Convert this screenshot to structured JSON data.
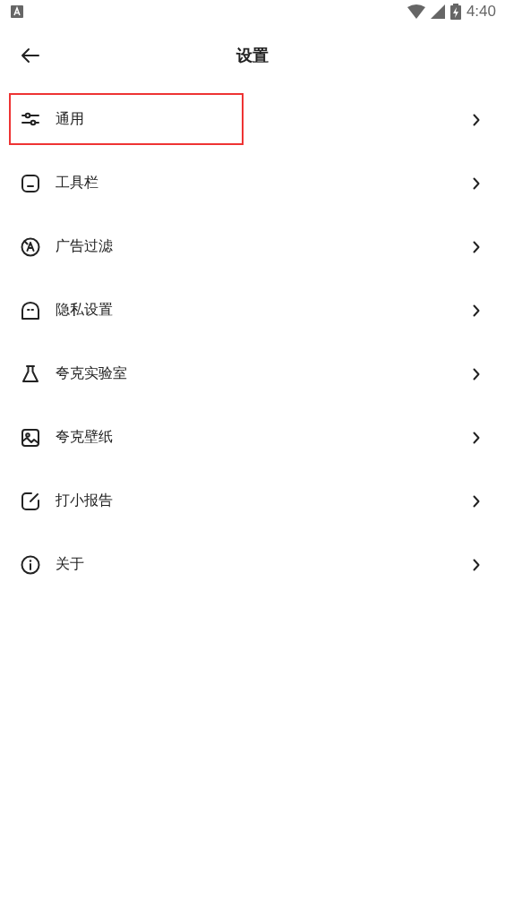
{
  "status_bar": {
    "time": "4:40"
  },
  "header": {
    "title": "设置"
  },
  "items": [
    {
      "label": "通用",
      "highlighted": true
    },
    {
      "label": "工具栏",
      "highlighted": false
    },
    {
      "label": "广告过滤",
      "highlighted": false
    },
    {
      "label": "隐私设置",
      "highlighted": false
    },
    {
      "label": "夸克实验室",
      "highlighted": false
    },
    {
      "label": "夸克壁纸",
      "highlighted": false
    },
    {
      "label": "打小报告",
      "highlighted": false
    },
    {
      "label": "关于",
      "highlighted": false
    }
  ]
}
